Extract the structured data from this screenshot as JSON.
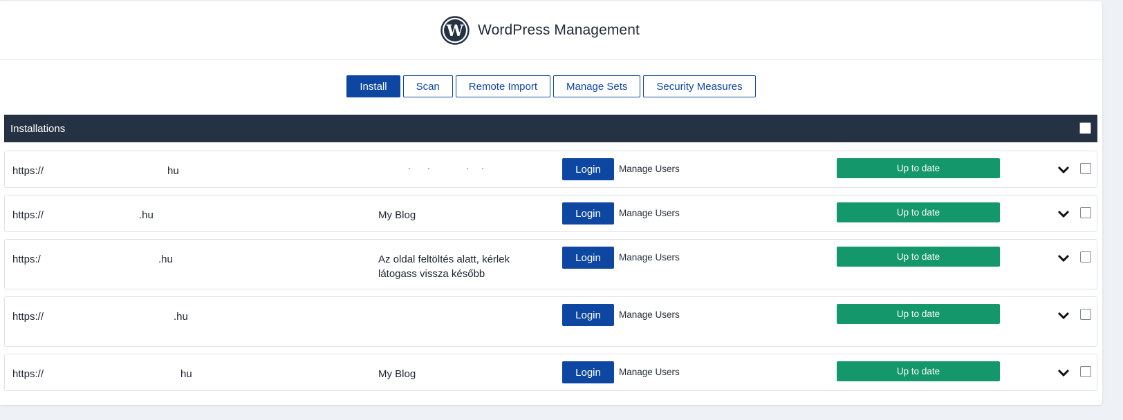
{
  "header": {
    "logo_icon": "wordpress-logo-icon",
    "title": "WordPress Management"
  },
  "tabs": [
    {
      "label": "Install",
      "active": true
    },
    {
      "label": "Scan",
      "active": false
    },
    {
      "label": "Remote Import",
      "active": false
    },
    {
      "label": "Manage Sets",
      "active": false
    },
    {
      "label": "Security Measures",
      "active": false
    }
  ],
  "table": {
    "header_label": "Installations",
    "rows": [
      {
        "url_prefix": "https://",
        "url_tail": "hu",
        "site_title": "",
        "login_label": "Login",
        "manage_label": "Manage Users",
        "status_label": "Up to date"
      },
      {
        "url_prefix": "https://",
        "url_tail": ".hu",
        "site_title": "My Blog",
        "login_label": "Login",
        "manage_label": "Manage Users",
        "status_label": "Up to date"
      },
      {
        "url_prefix": "https:/",
        "url_tail": ".hu",
        "site_title": "Az oldal feltöltés alatt, kérlek látogass vissza később",
        "login_label": "Login",
        "manage_label": "Manage Users",
        "status_label": "Up to date"
      },
      {
        "url_prefix": "https://",
        "url_tail": ".hu",
        "site_title": "",
        "login_label": "Login",
        "manage_label": "Manage Users",
        "status_label": "Up to date"
      },
      {
        "url_prefix": "https://",
        "url_tail": "hu",
        "site_title": "My Blog",
        "login_label": "Login",
        "manage_label": "Manage Users",
        "status_label": "Up to date"
      }
    ]
  },
  "colors": {
    "accent": "#0d47a1",
    "header_bar": "#253244",
    "status_ok": "#14976a"
  }
}
